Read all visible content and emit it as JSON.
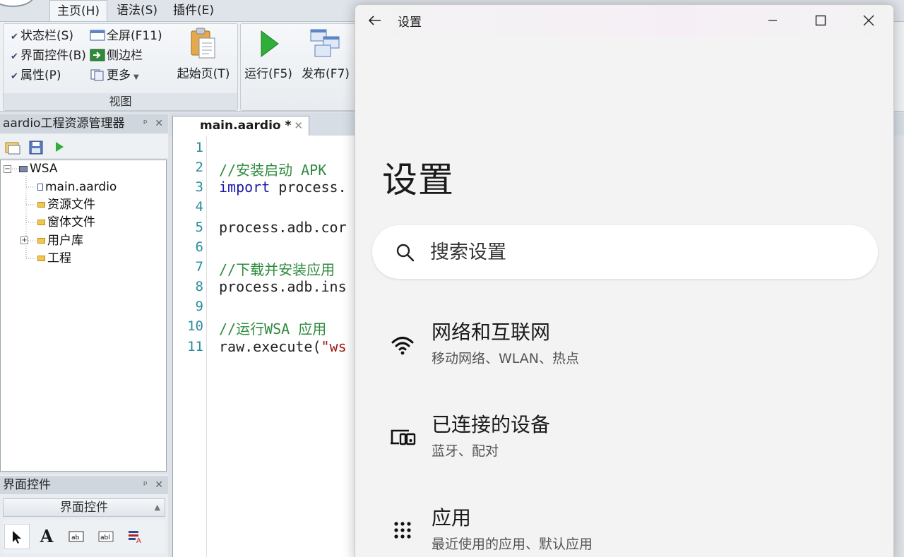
{
  "ide": {
    "menu": {
      "home": "主页(H)",
      "syntax": "语法(S)",
      "plugins": "插件(E)"
    },
    "ribbon": {
      "view_group": {
        "caption": "视图",
        "statusbar": "状态栏(S)",
        "ui_controls": "界面控件(B)",
        "properties": "属性(P)",
        "fullscreen": "全屏(F11)",
        "sidebar": "侧边栏",
        "more": "更多"
      },
      "start_page": "起始页(T)",
      "run": "运行(F5)",
      "publish": "发布(F7)"
    },
    "project_panel": {
      "title": "aardio工程资源管理器",
      "tree": {
        "root": "WSA",
        "items": [
          "main.aardio",
          "资源文件",
          "窗体文件",
          "用户库",
          "工程"
        ]
      }
    },
    "editor": {
      "tab_label": "main.aardio *",
      "line_numbers": [
        "1",
        "2",
        "3",
        "4",
        "5",
        "6",
        "7",
        "8",
        "9",
        "10",
        "11"
      ],
      "lines": {
        "l2": "//安装启动 APK",
        "l3_kw": "import",
        "l3_rest": " process.",
        "l5": "process.adb.cor",
        "l7": "//下载并安装应用",
        "l8": "process.adb.ins",
        "l10": "//运行WSA 应用",
        "l11_a": "raw.execute(",
        "l11_b": "\"ws"
      }
    },
    "ui_panel": {
      "title": "界面控件",
      "header": "界面控件"
    }
  },
  "settings": {
    "title_bar": "设置",
    "page_title": "设置",
    "search_placeholder": "搜索设置",
    "nav": [
      {
        "label": "网络和互联网",
        "sub": "移动网络、WLAN、热点"
      },
      {
        "label": "已连接的设备",
        "sub": "蓝牙、配对"
      },
      {
        "label": "应用",
        "sub": "最近使用的应用、默认应用"
      }
    ]
  },
  "colors": {
    "code_comment": "#2e8b3e",
    "code_keyword": "#1a1aa6",
    "code_string": "#a31515",
    "line_number": "#2a8c9e",
    "settings_bg": "#f3f3f3"
  }
}
